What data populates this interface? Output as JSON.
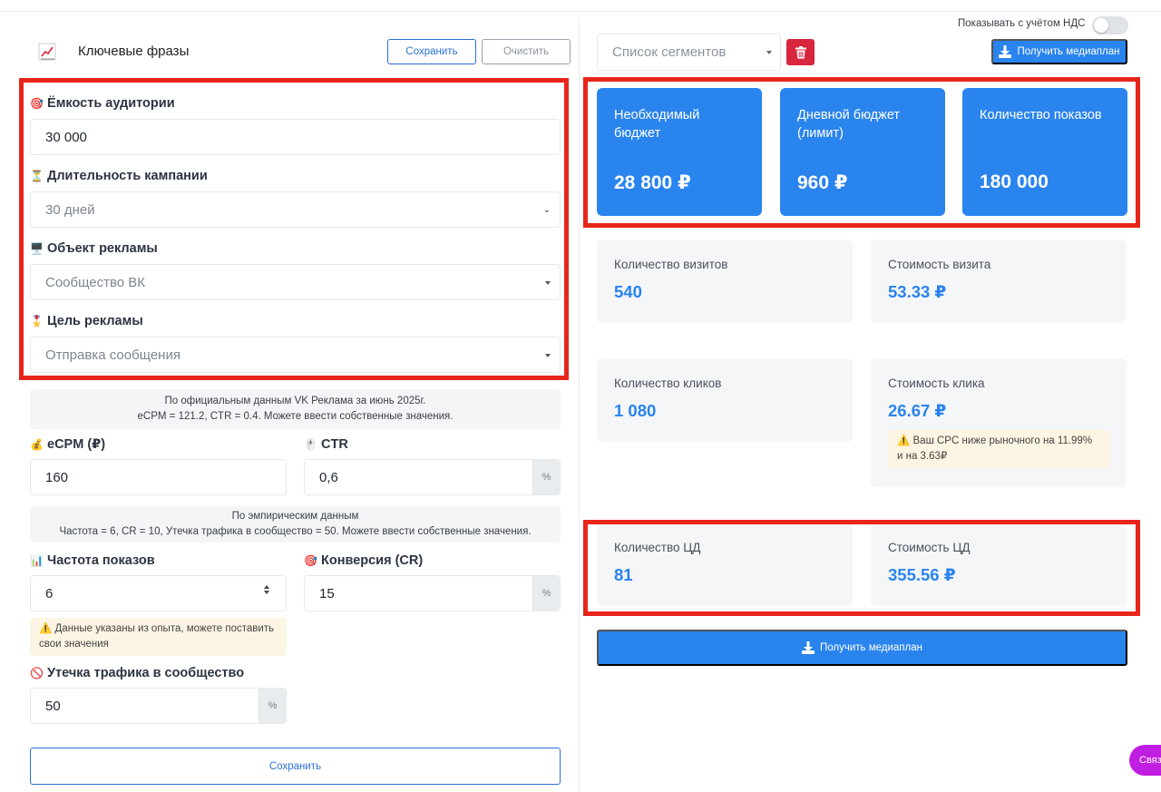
{
  "header": {
    "keywords_title": "Ключевые фразы",
    "save_label": "Сохранить",
    "clear_label": "Очистить",
    "segments_placeholder": "Список сегментов",
    "vat_label": "Показывать с учётом НДС",
    "vat_enabled": false,
    "mediaplan_label": "Получить медиаплан"
  },
  "form": {
    "audience": {
      "label": "Ёмкость аудитории",
      "value": "30 000"
    },
    "duration": {
      "label": "Длительность кампании",
      "value": "30 дней"
    },
    "ad_object": {
      "label": "Объект рекламы",
      "value": "Сообщество ВК"
    },
    "ad_goal": {
      "label": "Цель рекламы",
      "value": "Отправка сообщения"
    },
    "note_official": {
      "line1": "По официальным данным VK Реклама за июнь 2025г.",
      "line2": "eCPM = 121.2, CTR = 0.4. Можете ввести собственные значения."
    },
    "ecpm": {
      "label": "eCPM (₽)",
      "value": "160"
    },
    "ctr": {
      "label": "CTR",
      "value": "0,6",
      "suffix": "%"
    },
    "note_empirical": {
      "line1": "По эмпирическим данным",
      "line2": "Частота = 6, CR = 10, Утечка трафика в сообщество = 50. Можете ввести собственные значения."
    },
    "frequency": {
      "label": "Частота показов",
      "value": "6"
    },
    "conversion": {
      "label": "Конверсия (CR)",
      "value": "15",
      "suffix": "%"
    },
    "warn_experience": "⚠️ Данные указаны из опыта, можете поставить свои значения",
    "leak": {
      "label": "Утечка трафика в сообщество",
      "value": "50",
      "suffix": "%"
    },
    "save_label": "Сохранить"
  },
  "metrics": {
    "budget": {
      "title": "Необходимый бюджет",
      "value": "28 800 ₽"
    },
    "daily": {
      "title": "Дневной бюджет (лимит)",
      "value": "960 ₽"
    },
    "impressions": {
      "title": "Количество показов",
      "value": "180 000"
    },
    "visits": {
      "title": "Количество визитов",
      "value": "540"
    },
    "visit_cost": {
      "title": "Стоимость визита",
      "value": "53.33 ₽"
    },
    "clicks": {
      "title": "Количество кликов",
      "value": "1 080"
    },
    "click_cost": {
      "title": "Стоимость клика",
      "value": "26.67 ₽",
      "warning": "⚠️ Ваш CPC ниже рыночного на 11.99% и на 3.63₽"
    },
    "targets": {
      "title": "Количество ЦД",
      "value": "81"
    },
    "target_cost": {
      "title": "Стоимость ЦД",
      "value": "355.56 ₽"
    }
  },
  "chat": {
    "label": "Связ"
  },
  "colors": {
    "accent": "#2a84ee",
    "highlight": "#e8251b",
    "danger": "#d7263d",
    "chat": "#c01ee0"
  }
}
